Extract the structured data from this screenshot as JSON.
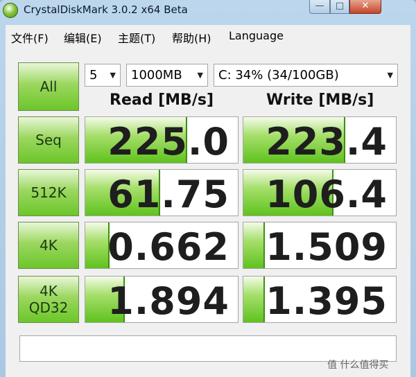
{
  "window": {
    "title": "CrystalDiskMark 3.0.2 x64 Beta",
    "minimize_glyph": "—",
    "maximize_glyph": "□",
    "close_glyph": "✕"
  },
  "menu": {
    "items": [
      "文件(F)",
      "编辑(E)",
      "主题(T)",
      "帮助(H)",
      "Language"
    ]
  },
  "controls": {
    "all_label": "All",
    "runs_value": "5",
    "size_value": "1000MB",
    "drive_value": "C: 34% (34/100GB)",
    "arrow": "▼"
  },
  "headers": {
    "read": "Read [MB/s]",
    "write": "Write [MB/s]"
  },
  "rows": [
    {
      "label": "Seq",
      "read": "225.0",
      "write": "223.4",
      "read_fill": 0.66,
      "write_fill": 0.66
    },
    {
      "label": "512K",
      "read": "61.75",
      "write": "106.4",
      "read_fill": 0.48,
      "write_fill": 0.58
    },
    {
      "label": "4K",
      "read": "0.662",
      "write": "1.509",
      "read_fill": 0.15,
      "write_fill": 0.13
    },
    {
      "label": "4K\nQD32",
      "read": "1.894",
      "write": "1.395",
      "read_fill": 0.25,
      "write_fill": 0.13
    }
  ],
  "status": {
    "text": ""
  },
  "watermark": {
    "text": "值 什么值得买"
  },
  "colors": {
    "green_light": "#a6df6b",
    "green_dark": "#5fc21d",
    "close_red": "#c6432a"
  }
}
